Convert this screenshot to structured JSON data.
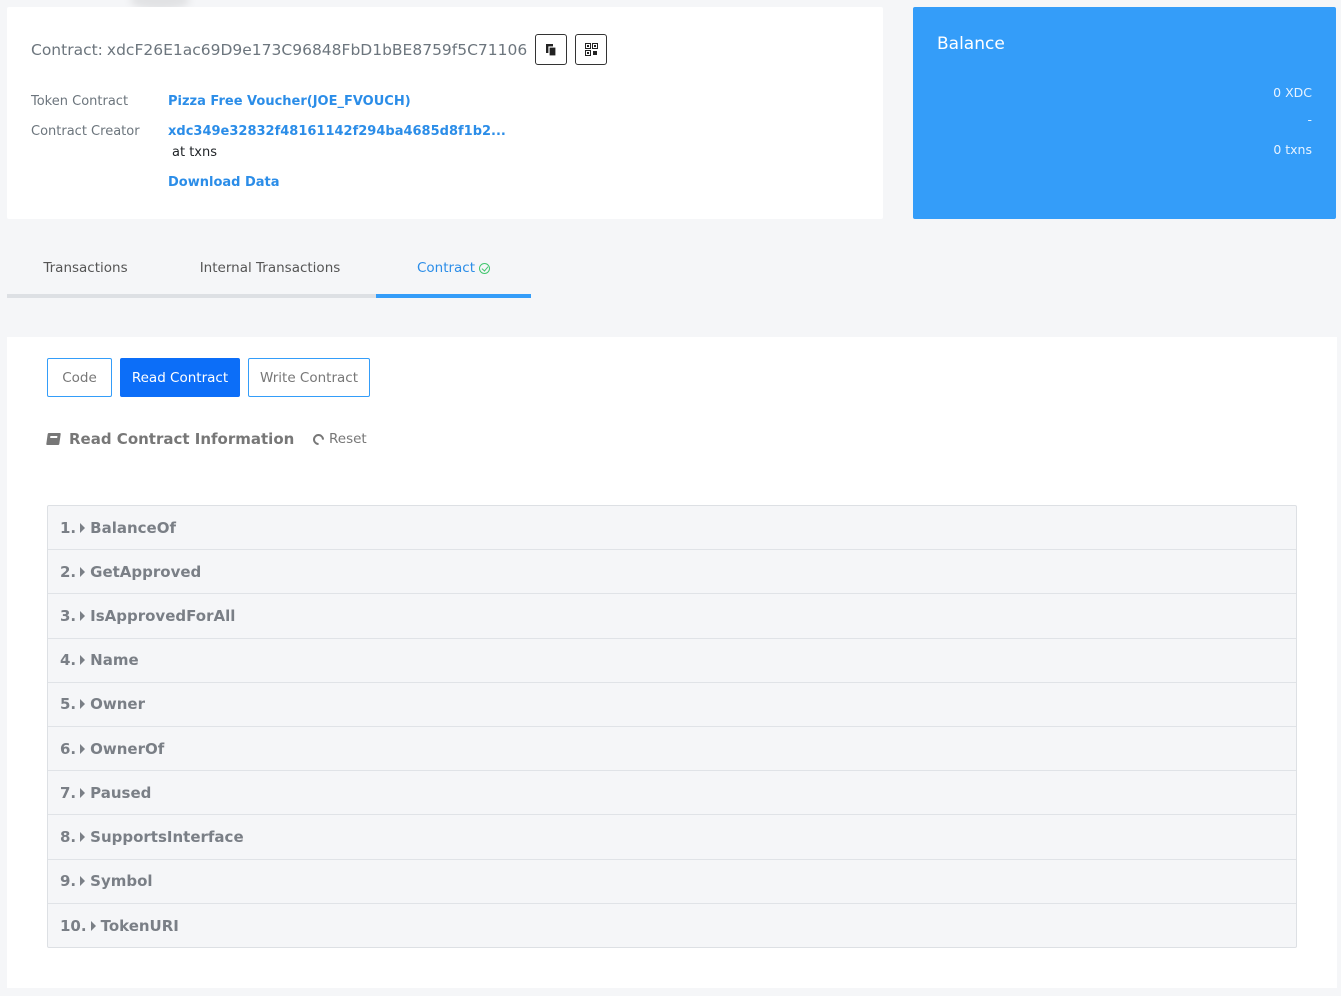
{
  "header": {
    "contract_label": "Contract:",
    "contract_address": "xdcF26E1ac69D9e173C96848FbD1bBE8759f5C71106",
    "copy_icon": "copy-icon",
    "qr_icon": "qr-code-icon"
  },
  "info": {
    "token_contract_label": "Token Contract",
    "token_contract_value": "Pizza Free Voucher(JOE_FVOUCH)",
    "contract_creator_label": "Contract Creator",
    "contract_creator_value": "xdc349e32832f48161142f294ba4685d8f1b2...",
    "at_txns": "at txns",
    "download_data": "Download Data"
  },
  "balance": {
    "title": "Balance",
    "amount": "0 XDC",
    "value": "-",
    "txns": "0 txns"
  },
  "tabs": [
    {
      "label": "Transactions",
      "active": false
    },
    {
      "label": "Internal Transactions",
      "active": false
    },
    {
      "label": "Contract",
      "active": true
    }
  ],
  "subtabs": {
    "code": "Code",
    "read_contract": "Read Contract",
    "write_contract": "Write Contract"
  },
  "read_section": {
    "title": "Read Contract Information",
    "reset": "Reset"
  },
  "functions": [
    {
      "num": "1.",
      "name": "BalanceOf"
    },
    {
      "num": "2.",
      "name": "GetApproved"
    },
    {
      "num": "3.",
      "name": "IsApprovedForAll"
    },
    {
      "num": "4.",
      "name": "Name"
    },
    {
      "num": "5.",
      "name": "Owner"
    },
    {
      "num": "6.",
      "name": "OwnerOf"
    },
    {
      "num": "7.",
      "name": "Paused"
    },
    {
      "num": "8.",
      "name": "SupportsInterface"
    },
    {
      "num": "9.",
      "name": "Symbol"
    },
    {
      "num": "10.",
      "name": "TokenURI"
    }
  ],
  "colors": {
    "accent": "#349df9",
    "primary_button": "#0c6ef8",
    "link": "#2b8de8",
    "verified": "#42c66f"
  }
}
